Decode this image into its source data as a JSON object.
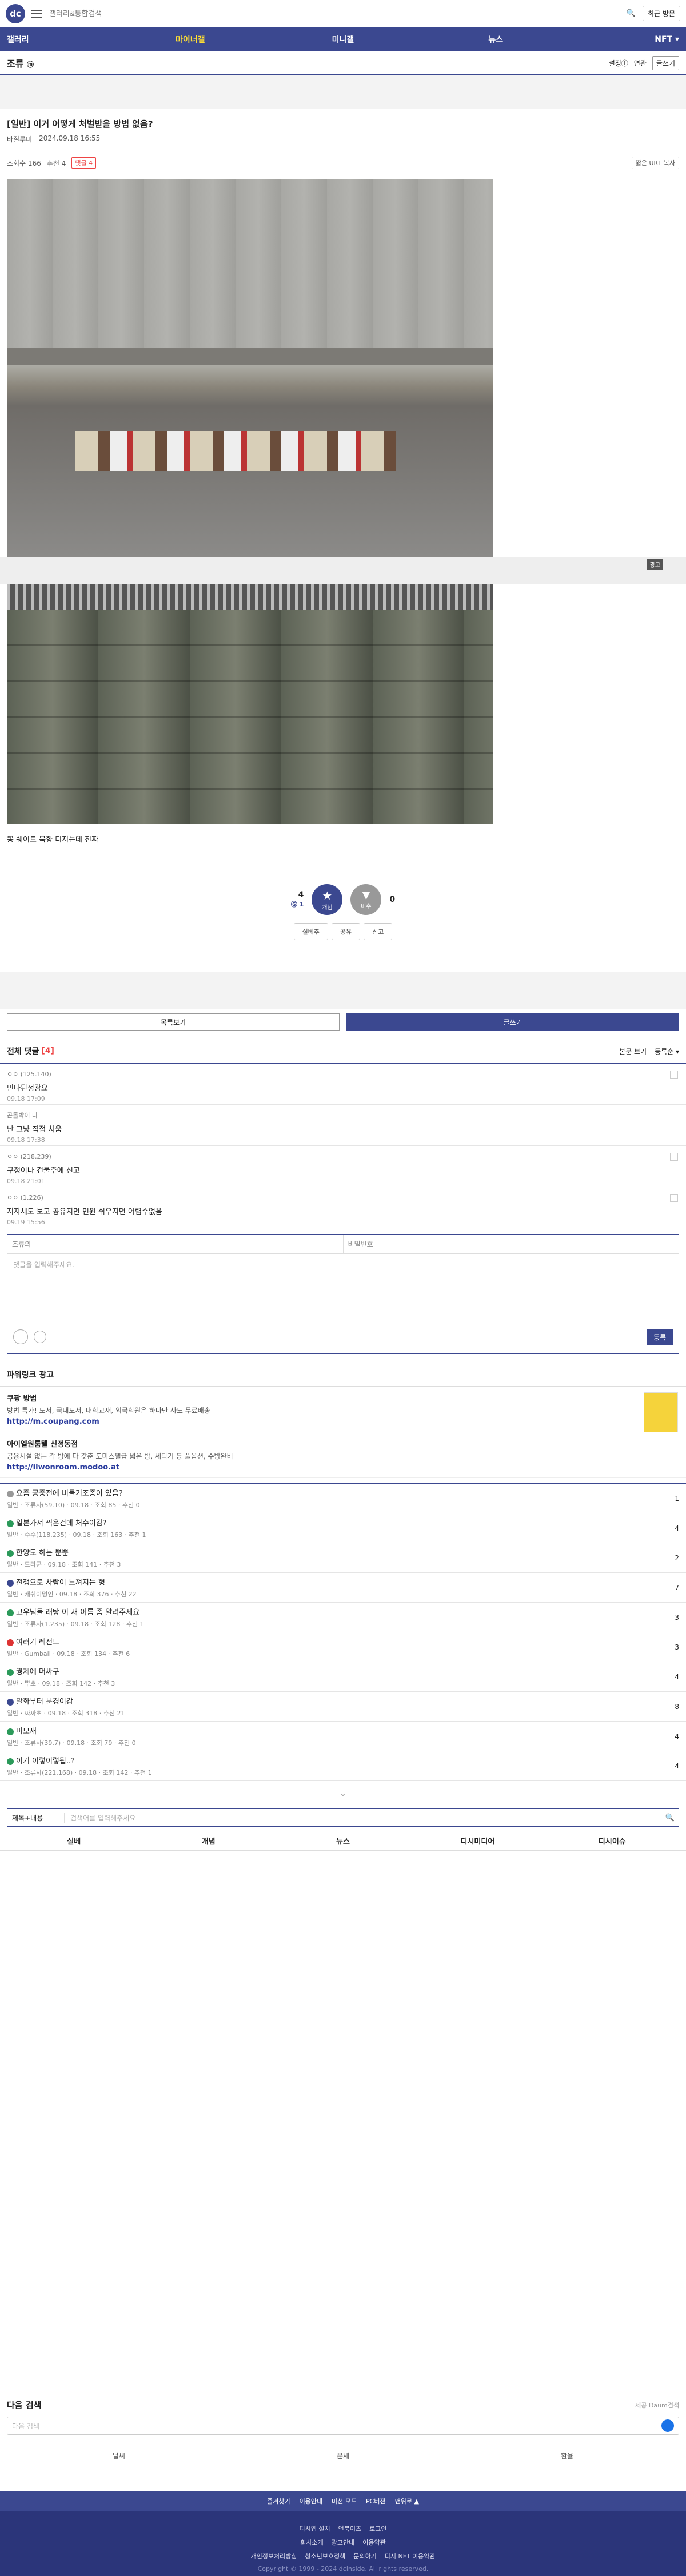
{
  "header": {
    "logo": "dc",
    "search_placeholder": "갤러리&통합검색",
    "login": "최근 방문"
  },
  "gnb": [
    "갤러리",
    "마이너갤",
    "미니갤",
    "뉴스",
    "NFT ▾"
  ],
  "gallery": {
    "title": "조류",
    "badge": "ⓜ",
    "tools": [
      "설정ⓘ",
      "연관",
      "글쓰기"
    ]
  },
  "post": {
    "title": "[일반] 이거 어떻게 처벌받을 방법 없음?",
    "author": "바질루미",
    "date": "2024.09.18 16:55",
    "views": "조회수 166",
    "recommend": "추천 4",
    "comments_badge": "댓글 4",
    "shorturl": "짧은 URL 복사",
    "ad_label": "광고",
    "caption": "뽕 쉐이트 북향 디지는데 진짜",
    "vote": {
      "up": "4",
      "up_fixed": "Ⓖ 1",
      "up_label": "개념",
      "down": "0",
      "down_label": "비추"
    },
    "actions": [
      "실베추",
      "공유",
      "신고"
    ]
  },
  "buttons": {
    "list": "목록보기",
    "write": "글쓰기"
  },
  "comments": {
    "title": "전체 댓글",
    "count": "[4]",
    "sort": "본문 보기",
    "sort2": "등록순 ▾",
    "items": [
      {
        "nick": "ㅇㅇ (125.140)",
        "text": "민다된정광요",
        "date": "09.18 17:09"
      },
      {
        "nick": "곤돌박이 다",
        "text": "난 그냥 직접 치움",
        "date": "09.18 17:38"
      },
      {
        "nick": "ㅇㅇ (218.239)",
        "text": "구청이나 건물주에 신고",
        "date": "09.18 21:01"
      },
      {
        "nick": "ㅇㅇ (1.226)",
        "text": "지자체도 보고 공유지면 민원 쉬우지면 어렵수없음",
        "date": "09.19 15:56"
      }
    ]
  },
  "cform": {
    "nick": "조류의",
    "pw": "비밀번호",
    "placeholder": "댓글을 입력해주세요.",
    "submit": "등록"
  },
  "powerlink": {
    "title": "파워링크 광고",
    "items": [
      {
        "title": "쿠팡 방법",
        "desc": "방법 특가! 도서, 국내도서, 대학교재, 외국학원은 하나만 사도 무료배송",
        "url": "http://m.coupang.com"
      },
      {
        "title": "아이엘원룸텔 신정동점",
        "desc": "공용시설 없는 각 방에 다 갖춘 도미스텔급 넓은 방, 세탁기 등 풀옵션, 수방완비",
        "url": "http://ilwonroom.modoo.at"
      }
    ]
  },
  "list": [
    {
      "t": "요즘 공중전에 비둘기조종이 있음?",
      "m": "일반 · 조류사(59.10) · 09.18 · 조회 85 · 추천 0",
      "c": "1",
      "ic": "g"
    },
    {
      "t": "일본가서 찍은건데 처수이감?",
      "m": "일반 · 수수(118.235) · 09.18 · 조회 163 · 추천 1",
      "c": "4",
      "ic": ""
    },
    {
      "t": "한양도 하는 뿐뿐",
      "m": "일반 · 드라군 · 09.18 · 조회 141 · 추천 3",
      "c": "2",
      "ic": ""
    },
    {
      "t": "전쟁으로 사람이 느껴지는 형",
      "m": "일반 · 캐쉬이명인 · 09.18 · 조회 376 · 추천 22",
      "c": "7",
      "ic": "b"
    },
    {
      "t": "고우님들 래탕 이 새 이름 좀 알려주세요",
      "m": "일반 · 조류사(1.235) · 09.18 · 조회 128 · 추천 1",
      "c": "3",
      "ic": ""
    },
    {
      "t": "여러기 레전드",
      "m": "일반 · Gumball · 09.18 · 조회 134 · 추천 6",
      "c": "3",
      "ic": "r"
    },
    {
      "t": "꿩제에 머싸구",
      "m": "일반 · 뿌뽀 · 09.18 · 조회 142 · 추천 3",
      "c": "4",
      "ic": ""
    },
    {
      "t": "말화부터 분경이감",
      "m": "일반 · 짜짜뽀 · 09.18 · 조회 318 · 추천 21",
      "c": "8",
      "ic": "b"
    },
    {
      "t": "미모새",
      "m": "일반 · 조류사(39.7) · 09.18 · 조회 79 · 추천 0",
      "c": "4",
      "ic": ""
    },
    {
      "t": "이거 이렇이렇됩..?",
      "m": "일반 · 조류사(221.168) · 09.18 · 조회 142 · 추천 1",
      "c": "4",
      "ic": ""
    }
  ],
  "search": {
    "select": "제목+내용",
    "placeholder": "검색어를 입력해주세요"
  },
  "tabs": [
    "실베",
    "개념",
    "뉴스",
    "디시미디어",
    "디시이슈"
  ],
  "next": {
    "title": "다음 검색",
    "powered": "제공 Daum검색",
    "placeholder": "다음 검색",
    "items": [
      "날씨",
      "운세",
      "환율"
    ]
  },
  "footer": {
    "row1": [
      "즐겨찾기",
      "이용안내",
      "미션 모드",
      "PC버전",
      "맨위로 ▲"
    ],
    "row2": [
      "디시앱 설치",
      "언북이츠",
      "로그인"
    ],
    "row3": [
      "회사소개",
      "광고안내",
      "이용약관"
    ],
    "row4": [
      "개인정보처리방침",
      "청소년보호정책",
      "문의하기",
      "디시 NFT 이용약관"
    ],
    "copyright": "Copyright © 1999 - 2024 dcinside. All rights reserved."
  }
}
